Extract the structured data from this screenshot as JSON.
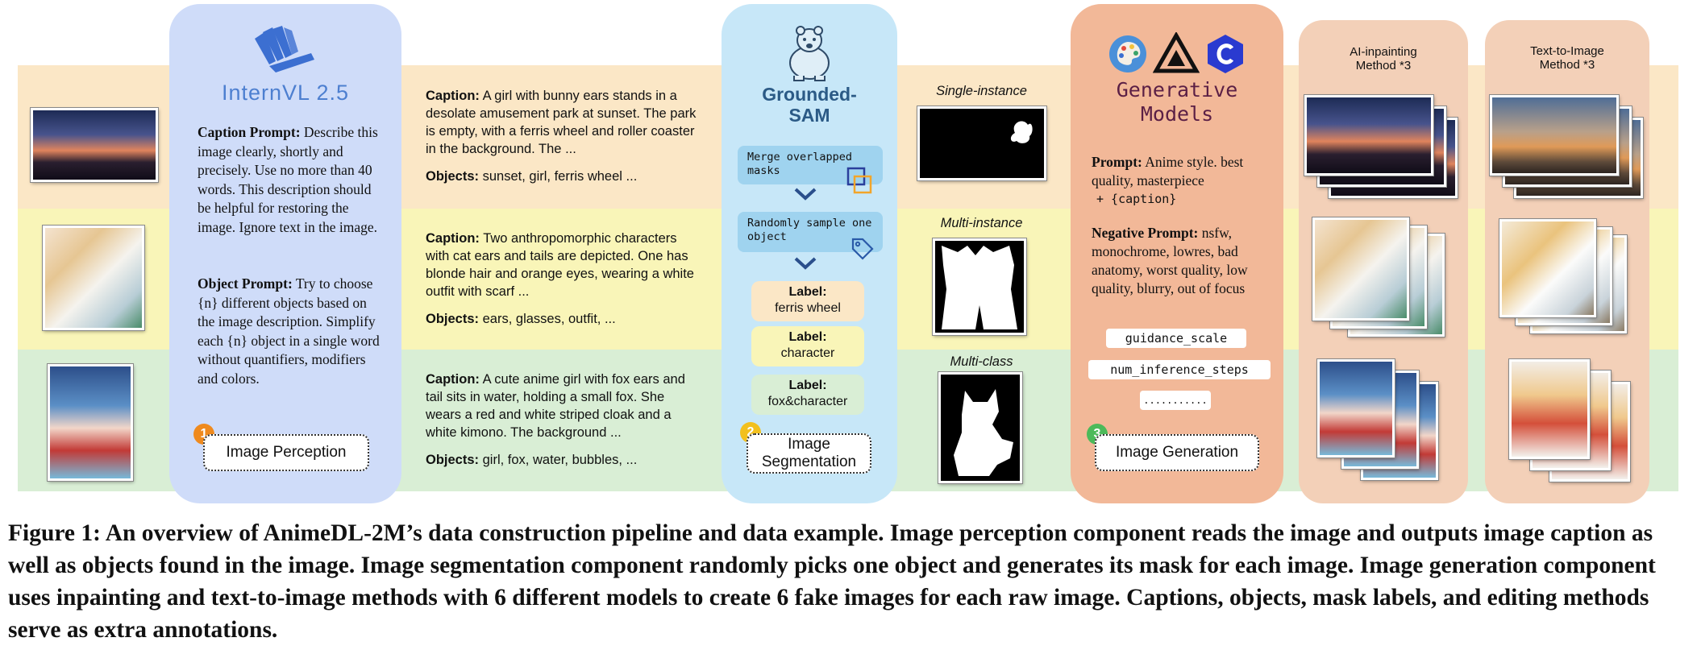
{
  "internvl": {
    "title": "InternVL 2.5",
    "caption_prompt_label": "Caption Prompt:",
    "caption_prompt": "Describe this image clearly, shortly and precisely. Use no more than 40 words. This description should be helpful for restoring the image. Ignore text in the image.",
    "object_prompt_label": "Object Prompt:",
    "object_prompt": "Try to choose {n} different objects based on the image description. Simplify each {n} object in a single word without quantifiers, modifiers and colors.",
    "step_number": "1",
    "step_label": "Image Perception"
  },
  "examples": [
    {
      "caption_label": "Caption:",
      "caption": "A girl with bunny ears stands in a desolate amusement park at sunset. The park is empty, with a ferris wheel and roller coaster in the background. The ...",
      "objects_label": "Objects:",
      "objects": "sunset, girl, ferris wheel ..."
    },
    {
      "caption_label": "Caption:",
      "caption": "Two anthropomorphic characters with cat ears and tails are depicted. One has blonde hair and orange eyes, wearing a white outfit with scarf ...",
      "objects_label": "Objects:",
      "objects": "ears, glasses, outfit, ..."
    },
    {
      "caption_label": "Caption:",
      "caption": "A cute anime girl with fox ears and tail sits in water, holding a small fox. She wears a red and white striped cloak and a white kimono. The background ...",
      "objects_label": "Objects:",
      "objects": "girl, fox, water, bubbles, ..."
    }
  ],
  "sam": {
    "title_line1": "Grounded-",
    "title_line2": "SAM",
    "step1": "Merge overlapped masks",
    "step2": "Randomly sample one object",
    "labels": [
      {
        "label": "Label:",
        "value": "ferris wheel"
      },
      {
        "label": "Label:",
        "value": "character"
      },
      {
        "label": "Label:",
        "value": "fox&character"
      }
    ],
    "step_number": "2",
    "step_label_line1": "Image",
    "step_label_line2": "Segmentation"
  },
  "masks": {
    "single": "Single-instance",
    "multi_instance": "Multi-instance",
    "multi_class": "Multi-class"
  },
  "generative": {
    "title_line1": "Generative",
    "title_line2": "Models",
    "prompt_label": "Prompt:",
    "prompt": "Anime style. best quality, masterpiece",
    "prompt_suffix": "+ {caption}",
    "negative_label": "Negative Prompt:",
    "negative": "nsfw, monochrome, lowres, bad anatomy, worst quality, low quality, blurry, out of focus",
    "params": [
      "guidance_scale",
      "num_inference_steps",
      "..........."
    ],
    "step_number": "3",
    "step_label": "Image Generation"
  },
  "methods": {
    "inpaint_line1": "AI-inpainting",
    "inpaint_line2": "Method *3",
    "t2i_line1": "Text-to-Image",
    "t2i_line2": "Method *3"
  },
  "figure_caption": "Figure 1: An overview of AnimeDL-2M’s data construction pipeline and data example. Image perception component reads the image and outputs image caption as well as objects found in the image. Image segmentation component randomly picks one object and generates its mask for each image. Image generation component uses inpainting and text-to-image methods with 6 different models to create 6 fake images for each raw image. Captions, objects, mask labels, and editing methods serve as extra annotations.",
  "colors": {
    "band1": "#fbe7c6",
    "band2": "#f9f5b8",
    "band3": "#d9eed5",
    "internvl_panel": "#cfdcf9",
    "sam_panel": "#c7e7f8",
    "gen_panel": "#f2b898",
    "step1_badge": "#ef8a1e",
    "step2_badge": "#f2c01e",
    "step3_badge": "#4cba5a",
    "gen_title": "#5b1f45",
    "sam_title": "#2b5a86",
    "internvl_title": "#4d7fd0"
  },
  "icons": [
    "internvl-logo-icon",
    "polar-bear-icon",
    "palette-icon",
    "triangle-logo-icon",
    "hexagon-c-icon",
    "chevron-down-icon",
    "tag-icon",
    "merge-squares-icon"
  ]
}
